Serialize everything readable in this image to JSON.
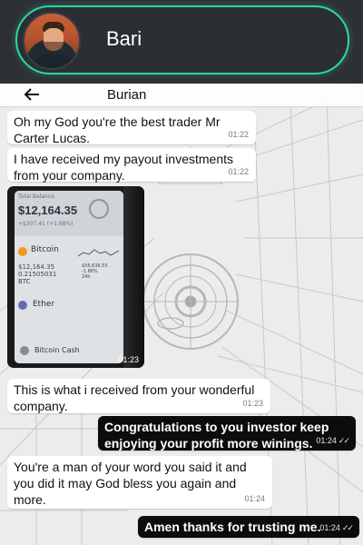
{
  "contact": {
    "name": "Bari"
  },
  "chat_header": {
    "title": "Burian"
  },
  "messages": [
    {
      "text": "Oh my God you're the best trader Mr Carter Lucas.",
      "time": "01:22"
    },
    {
      "text": "I have received my payout investments from your company.",
      "time": "01:22"
    },
    {
      "time": "01:23"
    },
    {
      "text": "This is what i received from your wonderful company.",
      "time": "01:23"
    },
    {
      "text": "Congratulations  to you investor keep enjoying your profit more winings.",
      "time": "01:24",
      "status": "read"
    },
    {
      "text": "You're a man of your word you said it and you did it may God bless you again and more.",
      "time": "01:24"
    },
    {
      "text": "Amen thanks for trusting me.",
      "time": "01:24",
      "status": "read"
    }
  ],
  "screenshot": {
    "label": "Total Balance",
    "balance": "$12,164.35",
    "change": "+$307.41 (+1.68%)",
    "coin1": "Bitcoin",
    "coin1_value": "$12,164.35",
    "coin1_amount": "0.21505031",
    "coin1_unit": "BTC",
    "coin1_price": "$56,636.55",
    "coin1_change": "-1.86%",
    "coin1_period": "24h",
    "coin2": "Ether",
    "coin3": "Bitcoin Cash"
  },
  "icons": {
    "back": "back-arrow-icon",
    "read_receipt": "double-check-icon",
    "btc": "bitcoin-icon",
    "eth": "ether-icon",
    "bch": "bitcoin-cash-icon"
  },
  "colors": {
    "accent": "#2fd6a0",
    "top_bar": "#2d3136",
    "incoming_bubble": "#ffffff",
    "outgoing_bubble": "#0c0c0c"
  }
}
